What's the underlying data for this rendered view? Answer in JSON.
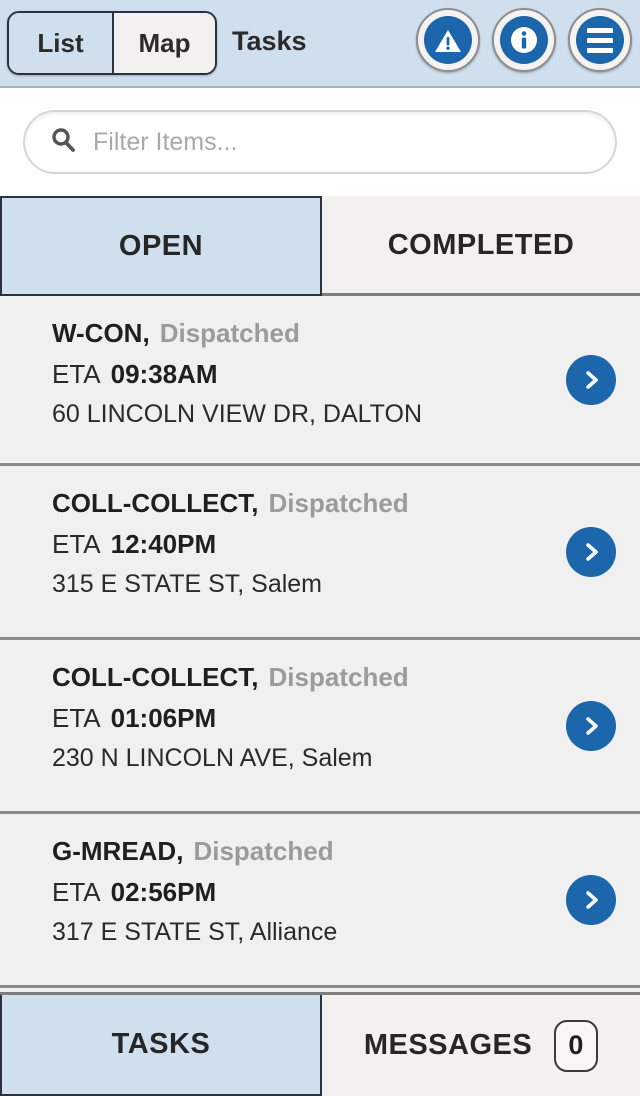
{
  "header": {
    "title": "Tasks",
    "view_toggle": {
      "options": [
        "List",
        "Map"
      ],
      "selected": "List",
      "list_label": "List",
      "map_label": "Map"
    },
    "icons": [
      {
        "name": "warning-icon",
        "glyph": "!"
      },
      {
        "name": "info-icon",
        "glyph": "i"
      },
      {
        "name": "menu-icon",
        "glyph": "hamburger"
      }
    ],
    "accent_color": "#1c66ab",
    "background_color": "#cfdfee"
  },
  "search": {
    "placeholder": "Filter Items...",
    "value": "",
    "icon": "search-icon"
  },
  "tabs": {
    "items": [
      {
        "label": "OPEN",
        "active": true
      },
      {
        "label": "COMPLETED",
        "active": false
      }
    ],
    "open_label": "OPEN",
    "completed_label": "COMPLETED"
  },
  "list": {
    "eta_label": "ETA",
    "tasks": [
      {
        "type": "W-CON,",
        "status": "Dispatched",
        "eta_label": "ETA",
        "eta": "09:38AM",
        "address": "60 LINCOLN VIEW DR, DALTON"
      },
      {
        "type": "COLL-COLLECT,",
        "status": "Dispatched",
        "eta_label": "ETA",
        "eta": "12:40PM",
        "address": "315 E STATE ST, Salem"
      },
      {
        "type": "COLL-COLLECT,",
        "status": "Dispatched",
        "eta_label": "ETA",
        "eta": "01:06PM",
        "address": "230 N LINCOLN AVE, Salem"
      },
      {
        "type": "G-MREAD,",
        "status": "Dispatched",
        "eta_label": "ETA",
        "eta": "02:56PM",
        "address": "317 E STATE ST, Alliance"
      }
    ]
  },
  "bottom_nav": {
    "items": [
      {
        "label": "TASKS",
        "active": true
      },
      {
        "label": "MESSAGES",
        "active": false
      }
    ],
    "tasks_label": "TASKS",
    "messages_label": "MESSAGES",
    "messages_count": "0"
  }
}
